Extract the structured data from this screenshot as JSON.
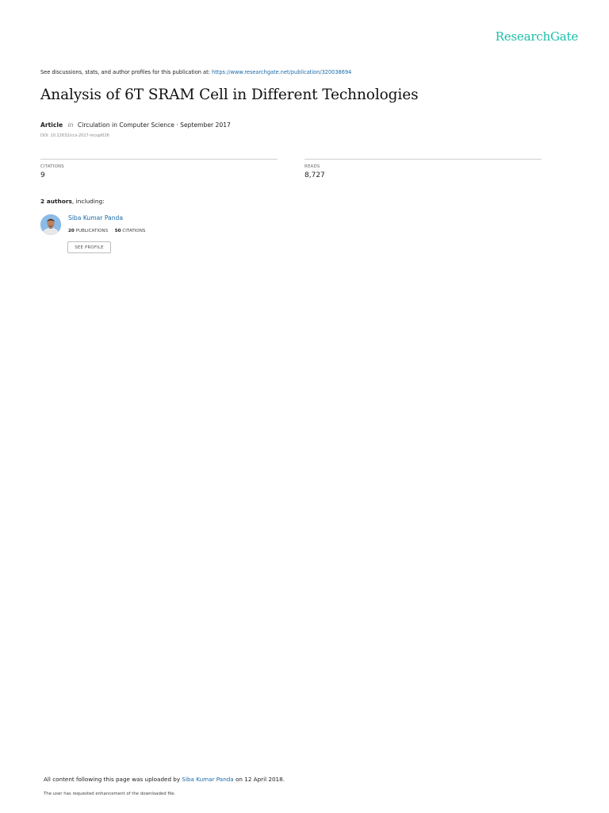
{
  "brand": {
    "name": "ResearchGate",
    "color": "#1bbfa6"
  },
  "header": {
    "discussions_text": "See discussions, stats, and author profiles for this publication at:",
    "publication_url": "https://www.researchgate.net/publication/320038694"
  },
  "publication": {
    "title": "Analysis of 6T SRAM Cell in Different Technologies",
    "type": "Article",
    "in_word": "in",
    "journal_date": "Circulation in Computer Science · September 2017",
    "doi": "DOI: 10.22632/ccs-2017-mcspl026"
  },
  "stats": {
    "citations_label": "CITATIONS",
    "citations_value": "9",
    "reads_label": "READS",
    "reads_value": "8,727"
  },
  "authors": {
    "count_text": "2 authors",
    "including_text": ", including:",
    "list": [
      {
        "name": "Siba Kumar Panda",
        "publications_count": "20",
        "publications_label": "PUBLICATIONS",
        "citations_count": "50",
        "citations_label": "CITATIONS",
        "profile_button": "SEE PROFILE"
      }
    ]
  },
  "footer": {
    "uploaded_prefix": "All content following this page was uploaded by",
    "uploader": "Siba Kumar Panda",
    "uploaded_suffix": "on 12 April 2018.",
    "enhancement_note": "The user has requested enhancement of the downloaded file."
  },
  "colors": {
    "link": "#1a6aa8",
    "divider": "#cfcfcf"
  }
}
